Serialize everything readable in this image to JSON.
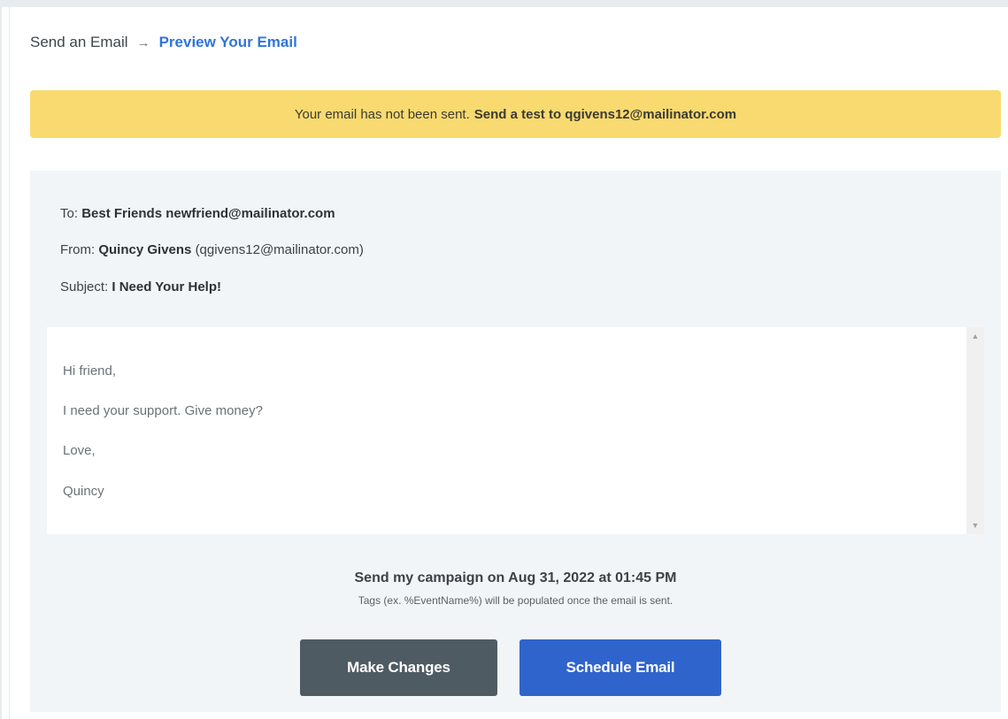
{
  "breadcrumb": {
    "step1": "Send an Email",
    "arrow": "→",
    "step2": "Preview Your Email"
  },
  "alert": {
    "message": "Your email has not been sent.",
    "action": "Send a test to qgivens12@mailinator.com"
  },
  "email": {
    "to_label": "To:",
    "to_value": "Best Friends newfriend@mailinator.com",
    "from_label": "From:",
    "from_name": "Quincy Givens",
    "from_email": "(qgivens12@mailinator.com)",
    "subject_label": "Subject:",
    "subject_value": "I Need Your Help!"
  },
  "body": {
    "lines": [
      "Hi friend,",
      "I need your support. Give money?",
      "Love,",
      "Quincy"
    ]
  },
  "schedule": {
    "text": "Send my campaign on Aug 31, 2022 at 01:45 PM",
    "note": "Tags (ex. %EventName%) will be populated once the email is sent."
  },
  "buttons": {
    "make_changes": "Make Changes",
    "schedule_email": "Schedule Email"
  },
  "colors": {
    "alert_bg": "#f8da70",
    "accent_blue": "#2f64cc",
    "secondary_btn": "#4f5b63",
    "link_blue": "#2f74de"
  },
  "icons": {
    "breadcrumb_arrow": "arrow-right-icon",
    "scroll_up": "chevron-up-icon",
    "scroll_down": "chevron-down-icon"
  }
}
